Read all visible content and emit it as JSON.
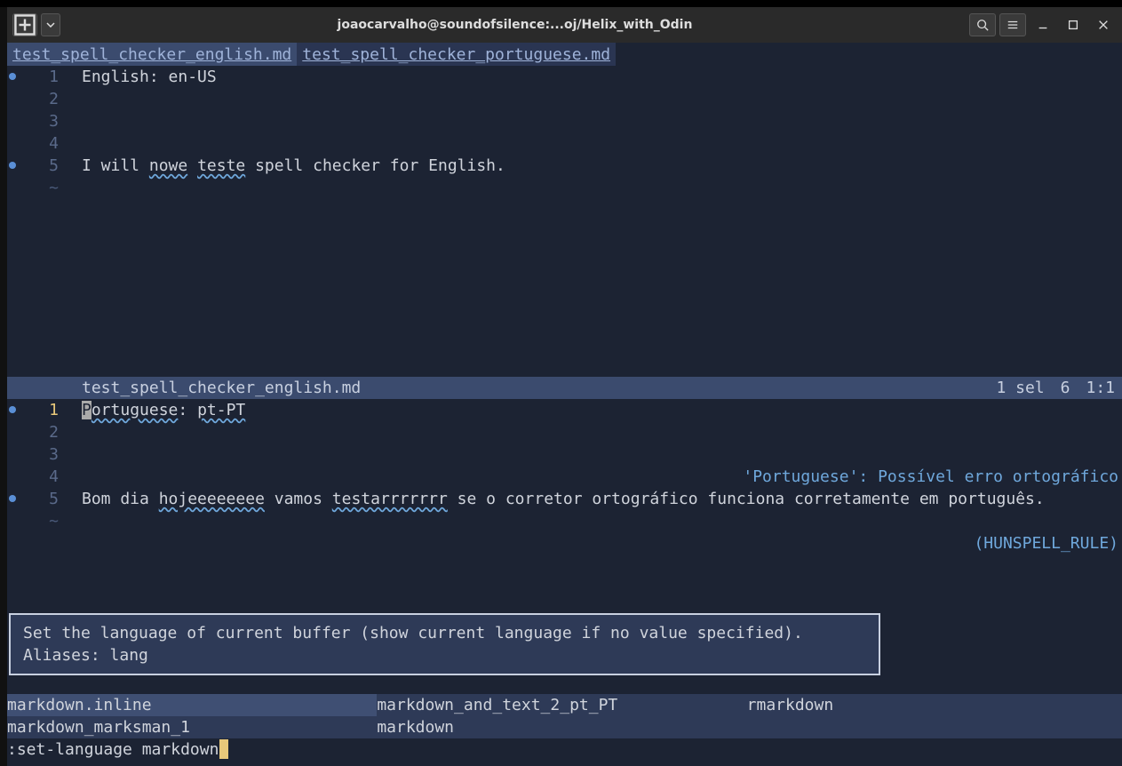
{
  "titlebar": {
    "title": "joaocarvalho@soundofsilence:...oj/Helix_with_Odin"
  },
  "tabs": {
    "t0": "test_spell_checker_english.md",
    "t1": "test_spell_checker_portuguese.md"
  },
  "pane_top": {
    "lines": {
      "l1a": "English: en-US",
      "l5a": "I will ",
      "l5b": "nowe",
      "l5c": " ",
      "l5d": "teste",
      "l5e": " spell checker for English."
    },
    "status": {
      "filename": "test_spell_checker_english.md",
      "sel": "1 sel",
      "six": "6",
      "pos": "1:1"
    },
    "ln": {
      "n1": "1",
      "n2": "2",
      "n3": "3",
      "n4": "4",
      "n5": "5",
      "tilde": "~"
    }
  },
  "pane_bot": {
    "lines": {
      "l1_cursor": "P",
      "l1a": "ortuguese",
      "l1b": ": ",
      "l1c": "pt-PT",
      "l5a": "Bom dia ",
      "l5b": "hojeeeeeeee",
      "l5c": " vamos ",
      "l5d": "testarrrrrrr",
      "l5e": " se o corretor ortográfico funciona corretamente em português."
    },
    "diagnostic": {
      "line1": "'Portuguese': Possível erro ortográfico",
      "line2": "(HUNSPELL_RULE)"
    },
    "ln": {
      "n1": "1",
      "n2": "2",
      "n3": "3",
      "n4": "4",
      "n5": "5",
      "tilde": "~"
    }
  },
  "help": {
    "line1": "Set the language of current buffer (show current language if no value specified).",
    "line2": "Aliases: lang"
  },
  "completions": {
    "c0": "markdown.inline",
    "c1": "markdown_and_text_2_pt_PT",
    "c2": "rmarkdown",
    "c3": "markdown_marksman_1",
    "c4": "markdown",
    "c5": ""
  },
  "command": {
    "text": ":set-language markdown"
  }
}
